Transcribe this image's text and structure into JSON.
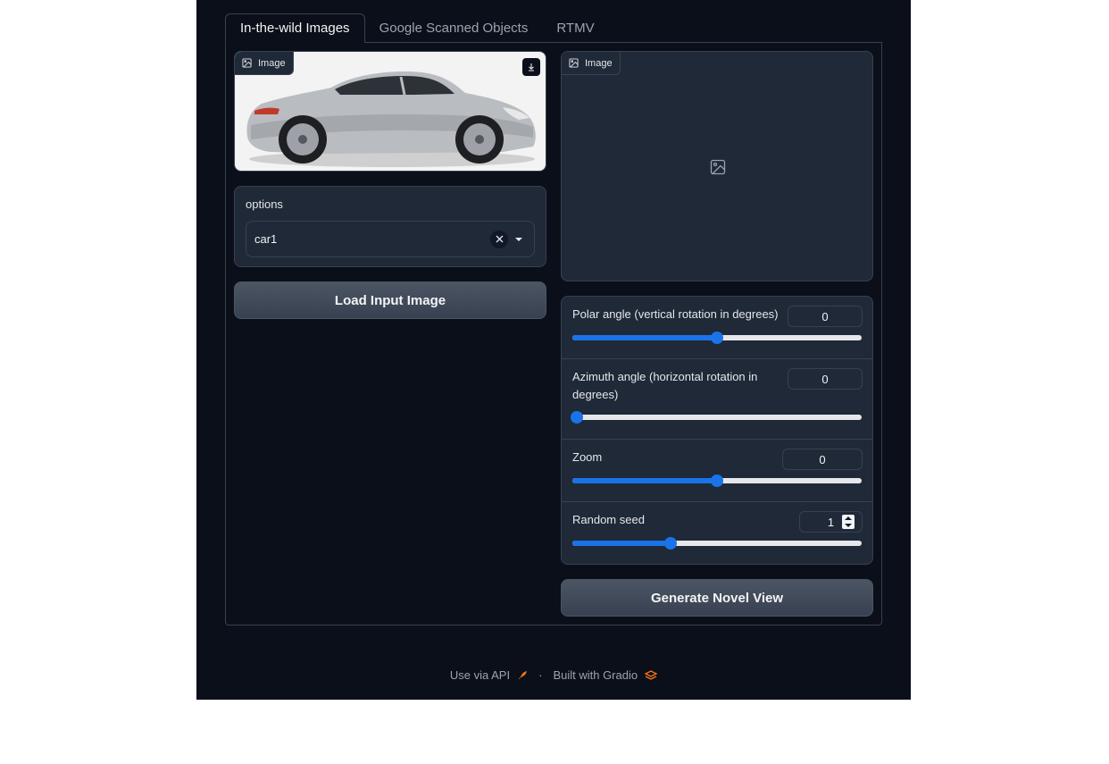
{
  "tabs": [
    {
      "label": "In-the-wild Images",
      "active": true
    },
    {
      "label": "Google Scanned Objects",
      "active": false
    },
    {
      "label": "RTMV",
      "active": false
    }
  ],
  "input_image": {
    "label": "Image"
  },
  "options": {
    "label": "options",
    "value": "car1"
  },
  "load_button": {
    "label": "Load Input Image"
  },
  "output_image": {
    "label": "Image"
  },
  "sliders": {
    "polar": {
      "label": "Polar angle (vertical rotation in degrees)",
      "value": "0",
      "fill_fraction": 0.5
    },
    "azimuth": {
      "label_line1": "Azimuth angle (horizontal rotation in",
      "label_line2": "degrees)",
      "value": "0",
      "fill_fraction": 0.0
    },
    "zoom": {
      "label": "Zoom",
      "value": "0",
      "fill_fraction": 0.5
    },
    "seed": {
      "label": "Random seed",
      "value": "1",
      "fill_fraction": 0.34
    }
  },
  "generate_button": {
    "label": "Generate Novel View"
  },
  "footer": {
    "api": "Use via API",
    "separator": "·",
    "built": "Built with Gradio"
  },
  "colors": {
    "accent": "#1a73e8",
    "background": "#0b0f19",
    "block": "#1f2937",
    "border": "#374151",
    "gradio_orange": "#f97316"
  }
}
